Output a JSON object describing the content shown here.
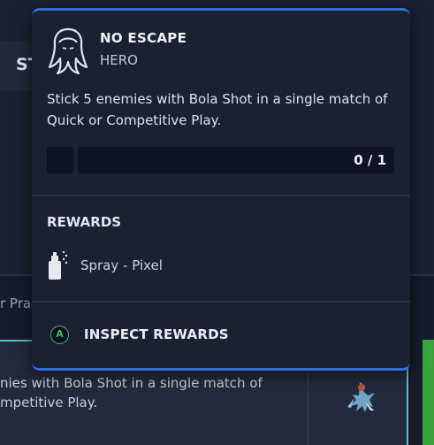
{
  "background": {
    "tab_text": "ST",
    "cut_text": "r Pra",
    "card_text": "nies with Bola Shot in a single match of\nmpetitive Play."
  },
  "tooltip": {
    "title": "NO ESCAPE",
    "category": "HERO",
    "description": "Stick 5 enemies with Bola Shot in a single match of Quick or Competitive Play.",
    "progress": {
      "current": 0,
      "total": 1,
      "text": "0 / 1"
    },
    "rewards_heading": "REWARDS",
    "reward_label": "Spray - Pixel",
    "inspect_button_glyph": "A",
    "inspect_label": "INSPECT REWARDS"
  },
  "icons": {
    "hero": "hero-portrait-icon",
    "spray": "spray-can-icon",
    "button": "gamepad-a-button-icon"
  },
  "colors": {
    "accent_border": "#2f6ee6",
    "panel_bg": "#1b2032",
    "button_green": "#3cc15a",
    "card_highlight": "#55c0cf"
  }
}
